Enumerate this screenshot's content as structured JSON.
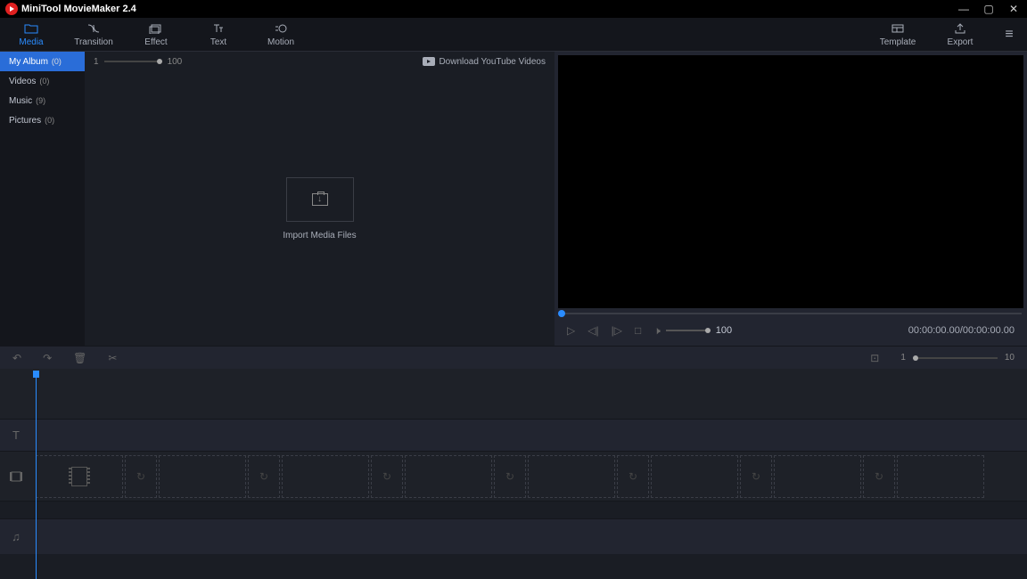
{
  "titlebar": {
    "title": "MiniTool MovieMaker 2.4"
  },
  "toolbar": {
    "tabs": [
      {
        "label": "Media",
        "active": true
      },
      {
        "label": "Transition"
      },
      {
        "label": "Effect"
      },
      {
        "label": "Text"
      },
      {
        "label": "Motion"
      }
    ],
    "right": [
      {
        "label": "Template"
      },
      {
        "label": "Export"
      }
    ]
  },
  "sidebar": {
    "items": [
      {
        "label": "My Album",
        "count": "(0)",
        "active": true
      },
      {
        "label": "Videos",
        "count": "(0)"
      },
      {
        "label": "Music",
        "count": "(9)"
      },
      {
        "label": "Pictures",
        "count": "(0)"
      }
    ]
  },
  "media": {
    "zoom_min": "1",
    "zoom_max": "100",
    "download_label": "Download YouTube Videos",
    "import_label": "Import Media Files"
  },
  "preview": {
    "volume": "100",
    "time": "00:00:00.00/00:00:00.00"
  },
  "timeline": {
    "zoom_min": "1",
    "zoom_max": "10"
  }
}
